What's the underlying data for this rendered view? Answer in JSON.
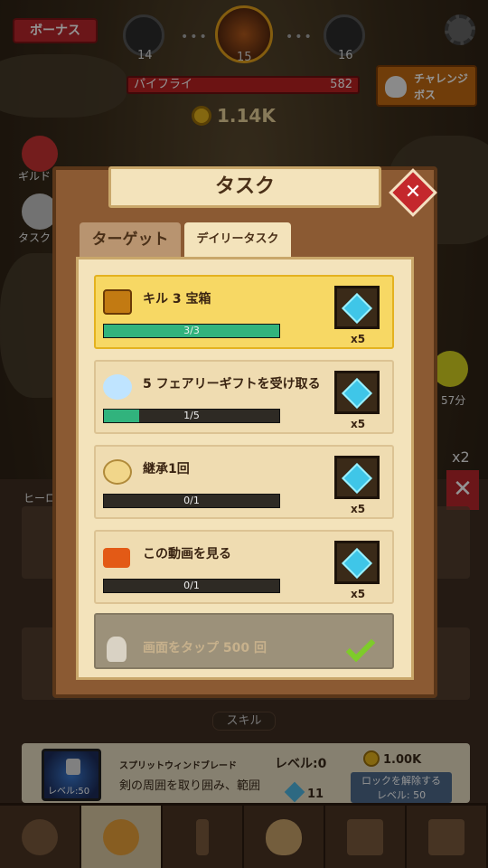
{
  "hud": {
    "bonus": "ボーナス",
    "stages": [
      "14",
      "15",
      "16"
    ],
    "boss_name": "パイフライ",
    "boss_hp": "582",
    "challenge_boss": [
      "チャレンジ",
      "ボス"
    ],
    "gold": "1.14K",
    "side_labels": {
      "guild": "ギルド",
      "task": "タスク",
      "timer": "57分",
      "multiplier": "x2",
      "hero": "ヒーロ"
    }
  },
  "modal": {
    "title": "タスク",
    "close": "✕",
    "tabs": [
      "ターゲット",
      "デイリータスク"
    ],
    "tasks": [
      {
        "label": "キル 3 宝箱",
        "progress_text": "3/3",
        "progress": 1.0,
        "reward_qty": "x5",
        "icon": "chest-icon"
      },
      {
        "label": "5 フェアリーギフトを受け取る",
        "progress_text": "1/5",
        "progress": 0.2,
        "reward_qty": "x5",
        "icon": "fairy-icon"
      },
      {
        "label": "継承1回",
        "progress_text": "0/1",
        "progress": 0.0,
        "reward_qty": "x5",
        "icon": "wings-icon"
      },
      {
        "label": "この動画を見る",
        "progress_text": "0/1",
        "progress": 0.0,
        "reward_qty": "x5",
        "icon": "video-icon"
      },
      {
        "label": "画面をタップ 500 回",
        "icon": "hand-icon",
        "completed_mark": "check-icon"
      }
    ]
  },
  "skills": {
    "header": "スキル",
    "name": "スプリットウィンドブレード",
    "level": "レベル:0",
    "thumb_level": "レベル:50",
    "desc": "剣の周囲を取り囲み、範囲",
    "cost": "1.00K",
    "unlock": [
      "ロックを解除する",
      "レベル: 50"
    ],
    "gem_cost": "11"
  },
  "colors": {
    "accent_red": "#c4282c",
    "progress_green": "#31b37d",
    "gem_blue": "#3fc6e8"
  }
}
